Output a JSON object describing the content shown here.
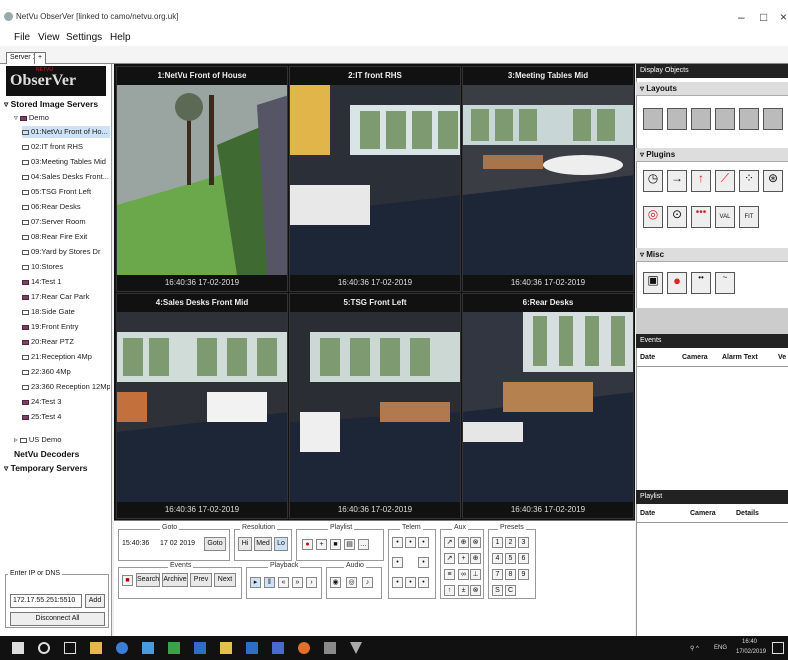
{
  "window": {
    "title": "NetVu ObserVer [linked to camo/netvu.org.uk]",
    "minimize": "–",
    "maximize": "□",
    "close": "×"
  },
  "menu": [
    "File",
    "View",
    "Settings",
    "Help"
  ],
  "tabs": [
    "Server 1",
    "+"
  ],
  "logo": {
    "text": "ObserVer",
    "sub": "NETVU"
  },
  "tree": {
    "stored_header": "Stored Image Servers",
    "server_name": "Demo",
    "items": [
      "01:NetVu Front of Ho...",
      "02:IT front RHS",
      "03:Meeting Tables Mid",
      "04:Sales Desks Front...",
      "05:TSG Front Left",
      "06:Rear Desks",
      "07:Server Room",
      "08:Rear Fire Exit",
      "09:Yard by Stores Dr",
      "10:Stores",
      "14:Test 1",
      "17:Rear Car Park",
      "18:Side Gate",
      "19:Front Entry",
      "20:Rear PTZ",
      "21:Reception 4Mp",
      "22:360 4Mp",
      "23:360 Reception 12Mp",
      "24:Test 3",
      "25:Test 4"
    ],
    "us_demo": "US Demo",
    "decoders": "NetVu Decoders",
    "temporary": "Temporary Servers"
  },
  "ip": {
    "legend": "Enter IP or DNS",
    "value": "172.17.55.251:5510",
    "add": "Add",
    "disconnect": "Disconnect All"
  },
  "cameras": [
    {
      "title": "1:NetVu Front of House",
      "ts": "16:40:36 17-02-2019"
    },
    {
      "title": "2:IT front RHS",
      "ts": "16:40:36 17-02-2019"
    },
    {
      "title": "3:Meeting Tables Mid",
      "ts": "16:40:36 17-02-2019"
    },
    {
      "title": "4:Sales Desks Front Mid",
      "ts": "16:40:36 17-02-2019"
    },
    {
      "title": "5:TSG Front Left",
      "ts": "16:40:36 17-02-2019"
    },
    {
      "title": "6:Rear Desks",
      "ts": "16:40:36 17-02-2019"
    }
  ],
  "controls": {
    "goto": "Goto",
    "goto_time": "15:40:36",
    "goto_date": "17 02 2019",
    "goto_btn": "Goto",
    "resolution": "Resolution",
    "res_hi": "Hi",
    "res_med": "Med",
    "res_lo": "Lo",
    "playlist": "Playlist",
    "events": "Events",
    "search": "Search",
    "archive": "Archive",
    "prev": "Prev",
    "next": "Next",
    "playback": "Playback",
    "audio": "Audio",
    "telem": "Telem",
    "aux": "Aux",
    "presets": "Presets"
  },
  "right": {
    "header": "Display Objects",
    "layouts": "Layouts",
    "plugins": "Plugins",
    "plugin_val": "VAL",
    "plugin_fit": "FIT",
    "misc": "Misc",
    "events_header": "Events",
    "events_cols": [
      "Date",
      "Camera",
      "Alarm Text",
      "Ve"
    ],
    "playlist_header": "Playlist",
    "playlist_cols": [
      "Date",
      "Camera",
      "Details"
    ]
  },
  "taskbar": {
    "lang": "ENG",
    "time": "16:40",
    "date": "17/02/2019"
  },
  "colors": {
    "accent": "#cde3f5",
    "video_bg": "#111111",
    "taskbar": "#111111"
  }
}
